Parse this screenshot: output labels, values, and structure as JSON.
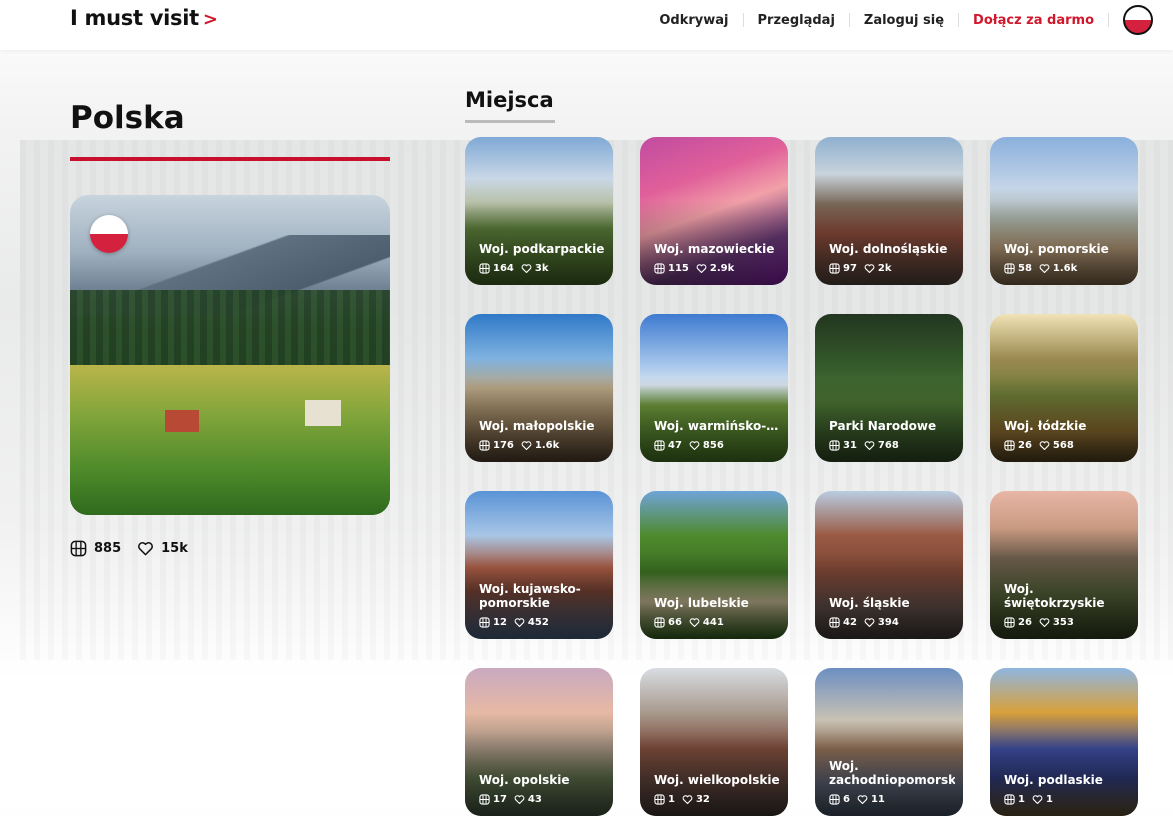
{
  "logo": {
    "text": "I must visit",
    "chevron": ">"
  },
  "nav": {
    "items": [
      "Odkrywaj",
      "Przeglądaj",
      "Zaloguj się"
    ],
    "join": "Dołącz za darmo",
    "colors": {
      "accent": "#d0172b"
    }
  },
  "country": {
    "name": "Polska",
    "places_count": "885",
    "likes": "15k"
  },
  "places": {
    "title": "Miejsca",
    "cards": [
      {
        "name": "Woj. podkarpackie",
        "places": "164",
        "likes": "3k",
        "bg": "linear-gradient(180deg,#7fa9d6 0%,#c9d7e6 28%,#b8c1a8 45%,#5b7d3a 62%,#3d5d22 100%)"
      },
      {
        "name": "Woj. mazowieckie",
        "places": "115",
        "likes": "2.9k",
        "bg": "linear-gradient(160deg,#c14ba0 0%,#e0609a 30%,#f2a0a8 50%,#6b3b7a 75%,#7a1b9e 100%)"
      },
      {
        "name": "Woj. dolnośląskie",
        "places": "97",
        "likes": "2k",
        "bg": "linear-gradient(180deg,#8fb0cf 0%,#c8d3dc 25%,#7a6a5a 45%,#8a4a3a 65%,#4b3f36 100%)"
      },
      {
        "name": "Woj. pomorskie",
        "places": "58",
        "likes": "1.6k",
        "bg": "linear-gradient(180deg,#8ab0dc 0%,#c6d5e8 35%,#a9b3a8 55%,#b59a78 75%,#6f5a40 100%)"
      },
      {
        "name": "Woj. małopolskie",
        "places": "176",
        "likes": "1.6k",
        "bg": "linear-gradient(180deg,#2f79c8 0%,#7fb2e0 30%,#b9a786 50%,#8e7656 75%,#4a3a2a 100%)"
      },
      {
        "name": "Woj. warmińsko-…",
        "places": "47",
        "likes": "856",
        "bg": "linear-gradient(180deg,#3d7ad0 0%,#a9c8ec 35%,#d8e3ee 48%,#6f9a3c 62%,#3e6b20 100%)"
      },
      {
        "name": "Parki Narodowe",
        "places": "31",
        "likes": "768",
        "bg": "linear-gradient(180deg,#22361f 0%,#355a2b 35%,#4c7534 60%,#2b4322 100%)"
      },
      {
        "name": "Woj. łódzkie",
        "places": "26",
        "likes": "568",
        "bg": "linear-gradient(180deg,#f0e3b6 0%,#9c8a52 30%,#6b7a36 55%,#8a6a2e 80%,#4a3a1e 100%)"
      },
      {
        "name": "Woj. kujawsko-pomorskie",
        "places": "12",
        "likes": "452",
        "bg": "linear-gradient(180deg,#5a93d6 0%,#a8c6e6 30%,#a65a42 52%,#6f3f32 68%,#3f5a78 100%)"
      },
      {
        "name": "Woj. lubelskie",
        "places": "66",
        "likes": "441",
        "bg": "linear-gradient(180deg,#6fa4d8 0%,#4f8a2e 30%,#3a6e22 55%,#b6aa88 75%,#2e5a1a 100%)"
      },
      {
        "name": "Woj. śląskie",
        "places": "42",
        "likes": "394",
        "bg": "linear-gradient(180deg,#b9cde2 0%,#9a5a44 30%,#7a4434 55%,#5a4a44 80%,#3a3432 100%)"
      },
      {
        "name": "Woj. świętokrzyskie",
        "places": "26",
        "likes": "353",
        "bg": "linear-gradient(180deg,#e8b6a6 0%,#c99a80 25%,#6a5a4a 45%,#4e5a34 70%,#2e3a1e 100%)"
      },
      {
        "name": "Woj. opolskie",
        "places": "17",
        "likes": "43",
        "bg": "linear-gradient(180deg,#c9a9c0 0%,#e6b9a4 30%,#9a8a7a 55%,#5a6a48 75%,#3a4a38 100%)"
      },
      {
        "name": "Woj. wielkopolskie",
        "places": "1",
        "likes": "32",
        "bg": "linear-gradient(180deg,#d8dde2 0%,#a99a8e 30%,#7a4a3a 55%,#5a4038 78%,#3a302c 100%)"
      },
      {
        "name": "Woj. zachodniopomorskie",
        "places": "6",
        "likes": "11",
        "bg": "linear-gradient(180deg,#6c8fc2 0%,#c9c2b4 35%,#8a6a52 55%,#5a6070 78%,#3a4656 100%)"
      },
      {
        "name": "Woj. podlaskie",
        "places": "1",
        "likes": "1",
        "bg": "linear-gradient(180deg,#8fb6e0 0%,#d9a03a 30%,#3a4a9a 55%,#2e3a78 75%,#5a4a2a 100%)"
      }
    ]
  }
}
